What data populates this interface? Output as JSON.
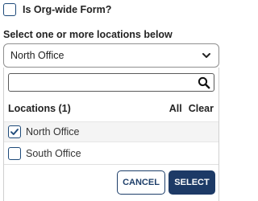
{
  "org_wide": {
    "label": "Is Org-wide Form?",
    "checked": false
  },
  "locations_select": {
    "label": "Select one or more locations below",
    "value": "North Office"
  },
  "dropdown": {
    "search": {
      "value": "",
      "placeholder": ""
    },
    "header": {
      "title": "Locations (1)",
      "all_label": "All",
      "clear_label": "Clear"
    },
    "options": [
      {
        "label": "North Office",
        "checked": true
      },
      {
        "label": "South Office",
        "checked": false
      }
    ],
    "cancel_label": "CANCEL",
    "select_label": "SELECT"
  },
  "colors": {
    "accent": "#1d3a66",
    "checkbox_border": "#1e4a7a",
    "selected_row_bg": "#f4f4f4"
  },
  "icons": {
    "search": "search-icon",
    "chevron": "chevron-down-icon",
    "check": "checkmark-icon"
  }
}
